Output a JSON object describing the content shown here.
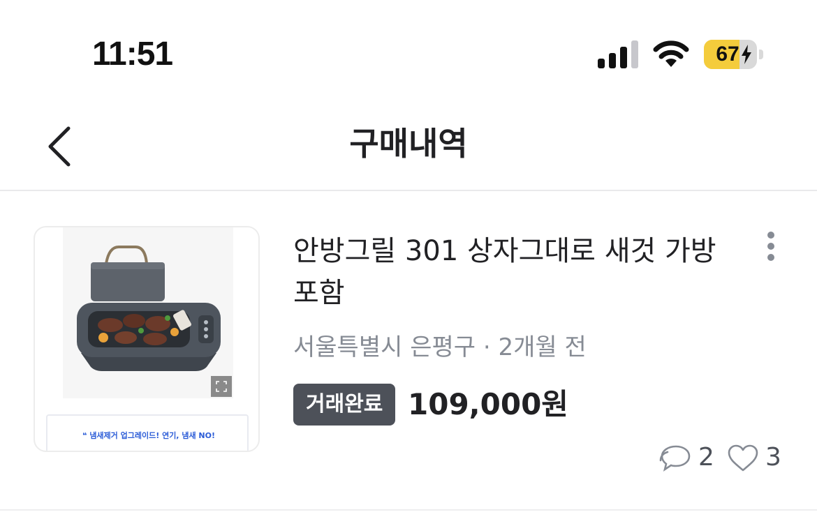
{
  "status_bar": {
    "time": "11:51",
    "battery_level": "67",
    "battery_percent": 67,
    "icons": [
      "cellular-signal-icon",
      "wifi-icon",
      "battery-charging-icon"
    ]
  },
  "header": {
    "title": "구매내역",
    "back_icon": "chevron-left-icon"
  },
  "item": {
    "title": "안방그릴 301 상자그대로 새것 가방포함",
    "location": "서울특별시 은평구",
    "separator": " · ",
    "time_ago": "2개월 전",
    "status": "거래완료",
    "price": "109,000원",
    "chat_count": "2",
    "like_count": "3",
    "thumbnail_banner": "❝ 냄새제거 업그레이드! 연기, 냄새 NO!",
    "more_icon": "more-vertical-icon"
  },
  "colors": {
    "battery_charging": "#f4cc3c",
    "badge_bg": "#4d5159",
    "meta_text": "#868b94",
    "banner_text": "#2a5bd7"
  }
}
